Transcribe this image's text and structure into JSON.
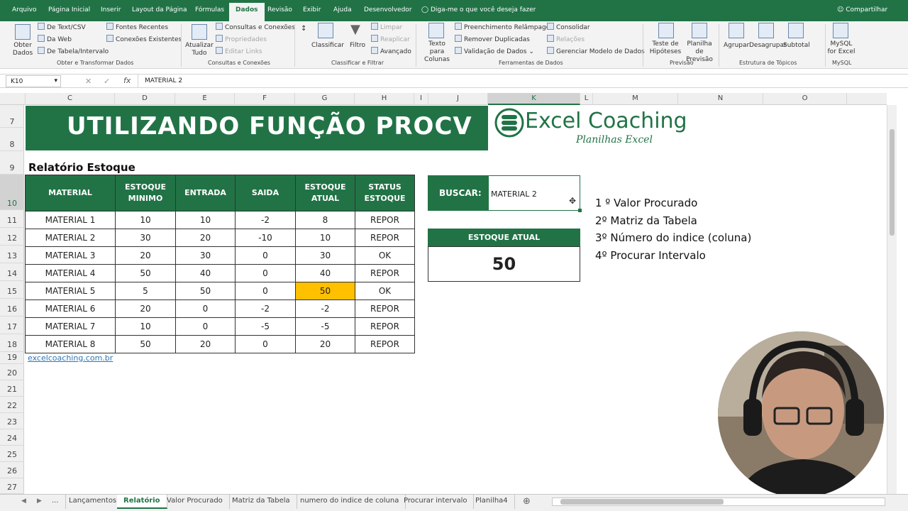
{
  "ribbon_tabs": [
    "Arquivo",
    "Página Inicial",
    "Inserir",
    "Layout da Página",
    "Fórmulas",
    "Dados",
    "Revisão",
    "Exibir",
    "Ajuda",
    "Desenvolvedor"
  ],
  "tell_me": "Diga-me o que você deseja fazer",
  "share": "Compartilhar",
  "groups": {
    "obter": {
      "big": "Obter Dados",
      "items": [
        "De Text/CSV",
        "Da Web",
        "De Tabela/Intervalo",
        "Fontes Recentes",
        "Conexões Existentes"
      ],
      "label": "Obter e Transformar Dados"
    },
    "consultas": {
      "big": "Atualizar Tudo",
      "items": [
        "Consultas e Conexões",
        "Propriedades",
        "Editar Links"
      ],
      "label": "Consultas e Conexões"
    },
    "classificar": {
      "classificar": "Classificar",
      "filtro": "Filtro",
      "items": [
        "Limpar",
        "Reaplicar",
        "Avançado"
      ],
      "label": "Classificar e Filtrar"
    },
    "ferramentas": {
      "big": "Texto para Colunas",
      "items": [
        "Preenchimento Relâmpago",
        "Remover Duplicadas",
        "Validação de Dados",
        "Consolidar",
        "Relações",
        "Gerenciar Modelo de Dados"
      ],
      "label": "Ferramentas de Dados"
    },
    "previsao": {
      "items": [
        "Teste de Hipóteses",
        "Planilha de Previsão"
      ],
      "label": "Previsão"
    },
    "topicos": {
      "items": [
        "Agrupar",
        "Desagrupar",
        "Subtotal"
      ],
      "label": "Estrutura de Tópicos"
    },
    "mysql": {
      "item": "MySQL for Excel",
      "label": "MySQL"
    }
  },
  "formula_bar": {
    "cell": "K10",
    "value": "MATERIAL 2"
  },
  "columns": [
    "C",
    "D",
    "E",
    "F",
    "G",
    "H",
    "I",
    "J",
    "K",
    "L",
    "M",
    "N",
    "O"
  ],
  "rows": [
    "7",
    "8",
    "9",
    "10",
    "11",
    "12",
    "13",
    "14",
    "15",
    "16",
    "17",
    "18",
    "19",
    "20",
    "21",
    "22",
    "23",
    "24",
    "25",
    "26",
    "27"
  ],
  "title": "UTILIZANDO FUNÇÃO PROCV",
  "logo": {
    "name": "Excel Coaching",
    "sub": "Planilhas Excel"
  },
  "report_title": "Relatório Estoque",
  "table": {
    "headers": [
      "MATERIAL",
      "ESTOQUE MINIMO",
      "ENTRADA",
      "SAIDA",
      "ESTOQUE ATUAL",
      "STATUS ESTOQUE"
    ],
    "rows": [
      [
        "MATERIAL 1",
        "10",
        "10",
        "-2",
        "8",
        "REPOR"
      ],
      [
        "MATERIAL 2",
        "30",
        "20",
        "-10",
        "10",
        "REPOR"
      ],
      [
        "MATERIAL 3",
        "20",
        "30",
        "0",
        "30",
        "OK"
      ],
      [
        "MATERIAL 4",
        "50",
        "40",
        "0",
        "40",
        "REPOR"
      ],
      [
        "MATERIAL 5",
        "5",
        "50",
        "0",
        "50",
        "OK"
      ],
      [
        "MATERIAL 6",
        "20",
        "0",
        "-2",
        "-2",
        "REPOR"
      ],
      [
        "MATERIAL 7",
        "10",
        "0",
        "-5",
        "-5",
        "REPOR"
      ],
      [
        "MATERIAL 8",
        "50",
        "20",
        "0",
        "20",
        "REPOR"
      ]
    ]
  },
  "link": "excelcoaching.com.br",
  "buscar": {
    "label": "BUSCAR:",
    "value": "MATERIAL 2"
  },
  "estoque": {
    "label": "ESTOQUE ATUAL",
    "value": "50"
  },
  "notes": [
    "1 º Valor Procurado",
    "2º Matriz da Tabela",
    "3º Número do indice (coluna)",
    "4º Procurar Intervalo"
  ],
  "sheets": [
    "...",
    "Lançamentos",
    "Relatório",
    "Valor Procurado",
    "Matriz da Tabela",
    "numero do indice de coluna",
    "Procurar intervalo",
    "Planilha4"
  ],
  "colors": {
    "green": "#217346",
    "highlight": "#ffc000"
  }
}
